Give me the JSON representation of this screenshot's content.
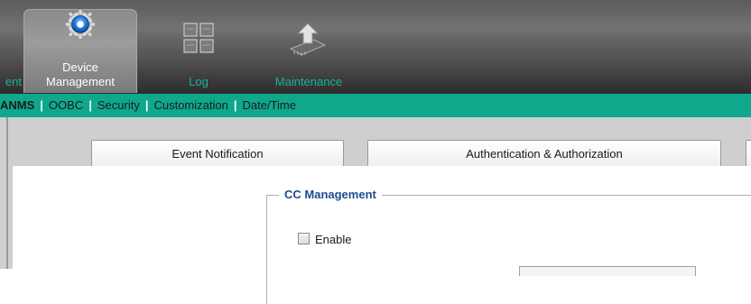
{
  "top_nav": {
    "tabs": [
      {
        "label": "ent",
        "active": false,
        "icon": "none"
      },
      {
        "label_line1": "Device",
        "label_line2": "Management",
        "active": true,
        "icon": "gear-icon"
      },
      {
        "label": "Log",
        "active": false,
        "icon": "log-grid-icon"
      },
      {
        "label": "Maintenance",
        "active": false,
        "icon": "upload-chip-icon"
      }
    ]
  },
  "sub_nav": {
    "items": [
      {
        "label": "ANMS",
        "active": true
      },
      {
        "label": "OOBC",
        "active": false
      },
      {
        "label": "Security",
        "active": false
      },
      {
        "label": "Customization",
        "active": false
      },
      {
        "label": "Date/Time",
        "active": false
      }
    ],
    "separator": "|"
  },
  "section_buttons": {
    "event_notification": "Event Notification",
    "auth": "Authentication & Authorization"
  },
  "cc_management": {
    "legend": "CC Management",
    "enable_label": "Enable",
    "enable_checked": false
  },
  "colors": {
    "accent": "#0fa88c",
    "inactive_tab_text": "#17b398",
    "legend_text": "#1e4b8f"
  }
}
